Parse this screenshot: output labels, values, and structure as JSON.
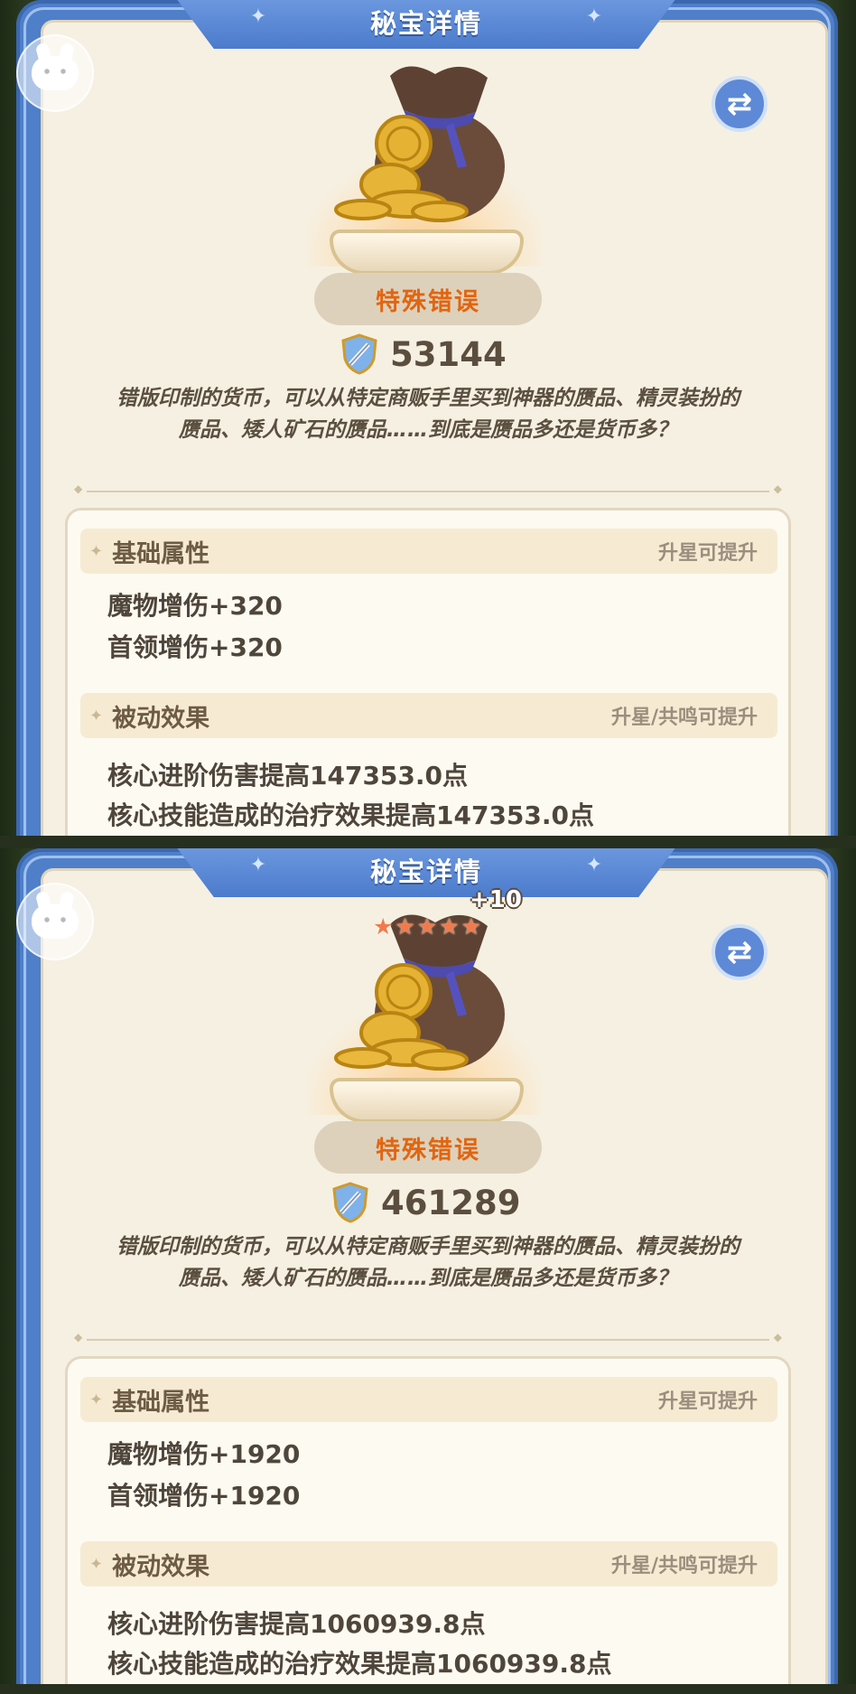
{
  "panels": [
    {
      "title": "秘宝详情",
      "rarity": "特殊错误",
      "power": "53144",
      "description": "错版印制的货币，可以从特定商贩手里买到神器的赝品、精灵装扮的赝品、矮人矿石的赝品……到底是赝品多还是货币多？",
      "level_badge": "",
      "stars": 0,
      "base": {
        "label": "基础属性",
        "note": "升星可提升",
        "stats": [
          "魔物增伤+320",
          "首领增伤+320"
        ]
      },
      "passive": {
        "label": "被动效果",
        "note": "升星/共鸣可提升",
        "stats": [
          "核心进阶伤害提高147353.0点",
          "核心技能造成的治疗效果提高147353.0点"
        ]
      }
    },
    {
      "title": "秘宝详情",
      "rarity": "特殊错误",
      "power": "461289",
      "description": "错版印制的货币，可以从特定商贩手里买到神器的赝品、精灵装扮的赝品、矮人矿石的赝品……到底是赝品多还是货币多？",
      "level_badge": "+10",
      "stars": 5,
      "base": {
        "label": "基础属性",
        "note": "升星可提升",
        "stats": [
          "魔物增伤+1920",
          "首领增伤+1920"
        ]
      },
      "passive": {
        "label": "被动效果",
        "note": "升星/共鸣可提升",
        "stats": [
          "核心进阶伤害提高1060939.8点",
          "核心技能造成的治疗效果提高1060939.8点"
        ]
      }
    }
  ],
  "icons": {
    "swap": "swap-icon",
    "chat": "chat-bubble-icon",
    "power": "sword-shield-icon",
    "item": "coin-bag-icon",
    "star": "star-icon"
  },
  "colors": {
    "frame": "#4f7fc9",
    "rarity_text": "#e2650f",
    "background": "#f6f0e2",
    "star": "#f27a4a"
  }
}
